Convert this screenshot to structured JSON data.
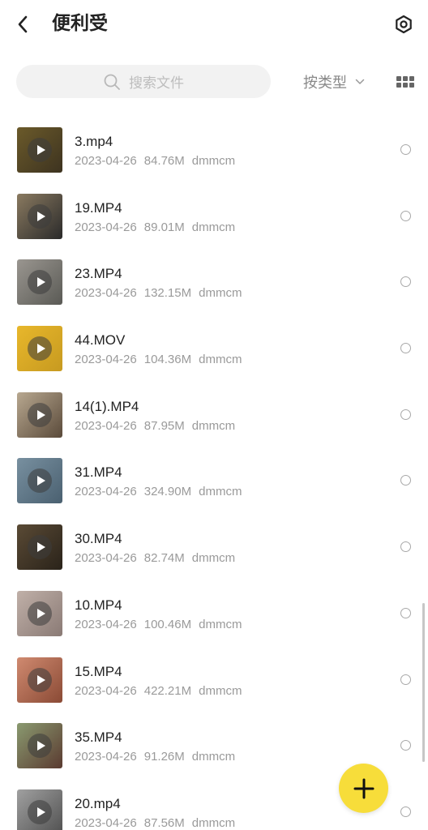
{
  "header": {
    "title": "便利受",
    "back_icon": "chevron-left-icon",
    "settings_icon": "hexagon-gear-icon"
  },
  "search": {
    "placeholder": "搜索文件"
  },
  "sort": {
    "label": "按类型"
  },
  "view_toggle_icon": "grid-view-icon",
  "files": [
    {
      "name": "3.mp4",
      "date": "2023-04-26",
      "size": "84.76M",
      "owner": "dmmcm",
      "thumb_colors": [
        "#6b5a2a",
        "#3d3320"
      ]
    },
    {
      "name": "19.MP4",
      "date": "2023-04-26",
      "size": "89.01M",
      "owner": "dmmcm",
      "thumb_colors": [
        "#8a7a60",
        "#2a2a2a"
      ]
    },
    {
      "name": "23.MP4",
      "date": "2023-04-26",
      "size": "132.15M",
      "owner": "dmmcm",
      "thumb_colors": [
        "#9a9690",
        "#5a5a55"
      ]
    },
    {
      "name": "44.MOV",
      "date": "2023-04-26",
      "size": "104.36M",
      "owner": "dmmcm",
      "thumb_colors": [
        "#e8b72b",
        "#c79a20"
      ]
    },
    {
      "name": "14(1).MP4",
      "date": "2023-04-26",
      "size": "87.95M",
      "owner": "dmmcm",
      "thumb_colors": [
        "#b8a890",
        "#5a4a3a"
      ]
    },
    {
      "name": "31.MP4",
      "date": "2023-04-26",
      "size": "324.90M",
      "owner": "dmmcm",
      "thumb_colors": [
        "#7890a0",
        "#4a6070"
      ]
    },
    {
      "name": "30.MP4",
      "date": "2023-04-26",
      "size": "82.74M",
      "owner": "dmmcm",
      "thumb_colors": [
        "#5a4a35",
        "#2a231a"
      ]
    },
    {
      "name": "10.MP4",
      "date": "2023-04-26",
      "size": "100.46M",
      "owner": "dmmcm",
      "thumb_colors": [
        "#c0b0a8",
        "#8a7a75"
      ]
    },
    {
      "name": "15.MP4",
      "date": "2023-04-26",
      "size": "422.21M",
      "owner": "dmmcm",
      "thumb_colors": [
        "#d08a70",
        "#8a4a35"
      ]
    },
    {
      "name": "35.MP4",
      "date": "2023-04-26",
      "size": "91.26M",
      "owner": "dmmcm",
      "thumb_colors": [
        "#8a9a70",
        "#5a3a30"
      ]
    },
    {
      "name": "20.mp4",
      "date": "2023-04-26",
      "size": "87.56M",
      "owner": "dmmcm",
      "thumb_colors": [
        "#a0a0a0",
        "#505050"
      ]
    }
  ],
  "fab_icon": "plus-icon",
  "colors": {
    "accent": "#f7dd3a",
    "title_text": "#222222",
    "meta_text": "#9a9a9a"
  }
}
